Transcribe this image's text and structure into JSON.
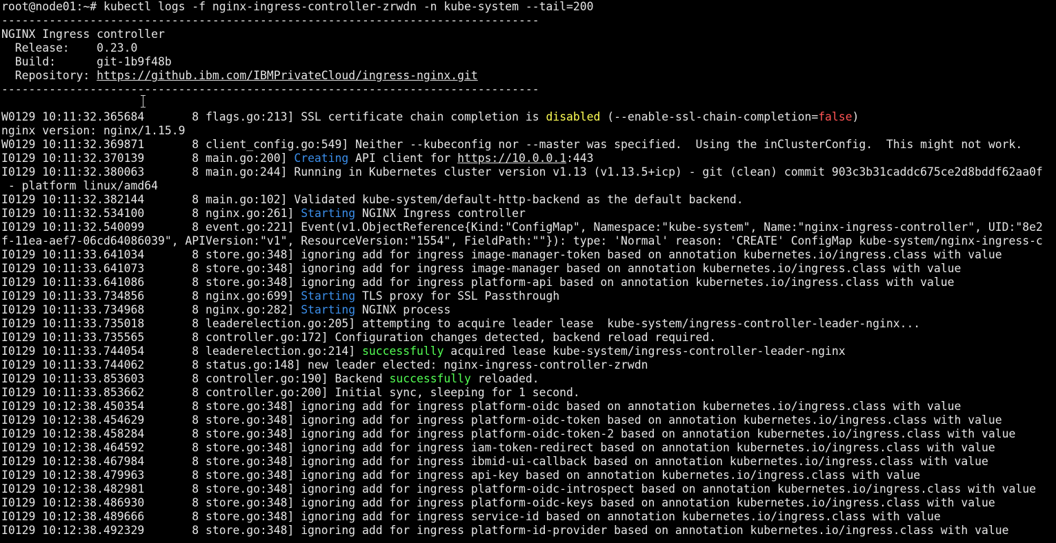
{
  "terminal": {
    "colors": {
      "background": "#000000",
      "text": "#e5e5e5",
      "yellow": "#ffff54",
      "red": "#ff5454",
      "blue": "#3b8eea",
      "green": "#54ff54"
    },
    "lines": [
      {
        "segments": [
          {
            "t": "root@node01:~# kubectl logs -f nginx-ingress-controller-zrwdn -n kube-system --tail=200",
            "c": "plain"
          }
        ]
      },
      {
        "segments": [
          {
            "t": "-------------------------------------------------------------------------------",
            "c": "plain"
          }
        ]
      },
      {
        "segments": [
          {
            "t": "NGINX Ingress controller",
            "c": "plain"
          }
        ]
      },
      {
        "segments": [
          {
            "t": "  Release:    0.23.0",
            "c": "plain"
          }
        ]
      },
      {
        "segments": [
          {
            "t": "  Build:      git-1b9f48b",
            "c": "plain"
          }
        ]
      },
      {
        "segments": [
          {
            "t": "  Repository: ",
            "c": "plain"
          },
          {
            "t": "https://github.ibm.com/IBMPrivateCloud/ingress-nginx.git",
            "c": "link"
          }
        ]
      },
      {
        "segments": [
          {
            "t": "-------------------------------------------------------------------------------",
            "c": "plain"
          }
        ]
      },
      {
        "segments": [
          {
            "t": "",
            "c": "plain"
          }
        ]
      },
      {
        "segments": [
          {
            "t": "W0129 10:11:32.365684       8 flags.go:213] SSL certificate chain completion is ",
            "c": "plain"
          },
          {
            "t": "disabled",
            "c": "yellow"
          },
          {
            "t": " (--enable-ssl-chain-completion=",
            "c": "plain"
          },
          {
            "t": "false",
            "c": "red"
          },
          {
            "t": ")",
            "c": "plain"
          }
        ]
      },
      {
        "segments": [
          {
            "t": "nginx version: nginx/1.15.9",
            "c": "plain"
          }
        ]
      },
      {
        "segments": [
          {
            "t": "W0129 10:11:32.369871       8 client_config.go:549] Neither --kubeconfig nor --master was specified.  Using the inClusterConfig.  This might not work.",
            "c": "plain"
          }
        ]
      },
      {
        "segments": [
          {
            "t": "I0129 10:11:32.370139       8 main.go:200] ",
            "c": "plain"
          },
          {
            "t": "Creating",
            "c": "blue"
          },
          {
            "t": " API client for ",
            "c": "plain"
          },
          {
            "t": "https://10.0.0.1",
            "c": "link"
          },
          {
            "t": ":443",
            "c": "plain"
          }
        ]
      },
      {
        "segments": [
          {
            "t": "I0129 10:11:32.380063       8 main.go:244] Running in Kubernetes cluster version v1.13 (v1.13.5+icp) - git (clean) commit 903c3b31caddc675ce2d8bddf62aa0f",
            "c": "plain"
          }
        ]
      },
      {
        "segments": [
          {
            "t": " - platform linux/amd64",
            "c": "plain"
          }
        ]
      },
      {
        "segments": [
          {
            "t": "I0129 10:11:32.382144       8 main.go:102] Validated kube-system/default-http-backend as the default backend.",
            "c": "plain"
          }
        ]
      },
      {
        "segments": [
          {
            "t": "I0129 10:11:32.534100       8 nginx.go:261] ",
            "c": "plain"
          },
          {
            "t": "Starting",
            "c": "blue"
          },
          {
            "t": " NGINX Ingress controller",
            "c": "plain"
          }
        ]
      },
      {
        "segments": [
          {
            "t": "I0129 10:11:32.540099       8 event.go:221] Event(v1.ObjectReference{Kind:\"ConfigMap\", Namespace:\"kube-system\", Name:\"nginx-ingress-controller\", UID:\"8e2",
            "c": "plain"
          }
        ]
      },
      {
        "segments": [
          {
            "t": "f-11ea-aef7-06cd64086039\", APIVersion:\"v1\", ResourceVersion:\"1554\", FieldPath:\"\"}): type: 'Normal' reason: 'CREATE' ConfigMap kube-system/nginx-ingress-c",
            "c": "plain"
          }
        ]
      },
      {
        "segments": [
          {
            "t": "I0129 10:11:33.641034       8 store.go:348] ignoring add for ingress image-manager-token based on annotation kubernetes.io/ingress.class with value",
            "c": "plain"
          }
        ]
      },
      {
        "segments": [
          {
            "t": "I0129 10:11:33.641073       8 store.go:348] ignoring add for ingress image-manager based on annotation kubernetes.io/ingress.class with value",
            "c": "plain"
          }
        ]
      },
      {
        "segments": [
          {
            "t": "I0129 10:11:33.641086       8 store.go:348] ignoring add for ingress platform-api based on annotation kubernetes.io/ingress.class with value",
            "c": "plain"
          }
        ]
      },
      {
        "segments": [
          {
            "t": "I0129 10:11:33.734856       8 nginx.go:699] ",
            "c": "plain"
          },
          {
            "t": "Starting",
            "c": "blue"
          },
          {
            "t": " TLS proxy for SSL Passthrough",
            "c": "plain"
          }
        ]
      },
      {
        "segments": [
          {
            "t": "I0129 10:11:33.734968       8 nginx.go:282] ",
            "c": "plain"
          },
          {
            "t": "Starting",
            "c": "blue"
          },
          {
            "t": " NGINX process",
            "c": "plain"
          }
        ]
      },
      {
        "segments": [
          {
            "t": "I0129 10:11:33.735018       8 leaderelection.go:205] attempting to acquire leader lease  kube-system/ingress-controller-leader-nginx...",
            "c": "plain"
          }
        ]
      },
      {
        "segments": [
          {
            "t": "I0129 10:11:33.735565       8 controller.go:172] Configuration changes detected, backend reload required.",
            "c": "plain"
          }
        ]
      },
      {
        "segments": [
          {
            "t": "I0129 10:11:33.744054       8 leaderelection.go:214] ",
            "c": "plain"
          },
          {
            "t": "successfully",
            "c": "green"
          },
          {
            "t": " acquired lease kube-system/ingress-controller-leader-nginx",
            "c": "plain"
          }
        ]
      },
      {
        "segments": [
          {
            "t": "I0129 10:11:33.744062       8 status.go:148] new leader elected: nginx-ingress-controller-zrwdn",
            "c": "plain"
          }
        ]
      },
      {
        "segments": [
          {
            "t": "I0129 10:11:33.853603       8 controller.go:190] Backend ",
            "c": "plain"
          },
          {
            "t": "successfully",
            "c": "green"
          },
          {
            "t": " reloaded.",
            "c": "plain"
          }
        ]
      },
      {
        "segments": [
          {
            "t": "I0129 10:11:33.853662       8 controller.go:200] Initial sync, sleeping for 1 second.",
            "c": "plain"
          }
        ]
      },
      {
        "segments": [
          {
            "t": "I0129 10:12:38.450354       8 store.go:348] ignoring add for ingress platform-oidc based on annotation kubernetes.io/ingress.class with value",
            "c": "plain"
          }
        ]
      },
      {
        "segments": [
          {
            "t": "I0129 10:12:38.454629       8 store.go:348] ignoring add for ingress platform-oidc-token based on annotation kubernetes.io/ingress.class with value",
            "c": "plain"
          }
        ]
      },
      {
        "segments": [
          {
            "t": "I0129 10:12:38.458284       8 store.go:348] ignoring add for ingress platform-oidc-token-2 based on annotation kubernetes.io/ingress.class with value",
            "c": "plain"
          }
        ]
      },
      {
        "segments": [
          {
            "t": "I0129 10:12:38.464592       8 store.go:348] ignoring add for ingress iam-token-redirect based on annotation kubernetes.io/ingress.class with value",
            "c": "plain"
          }
        ]
      },
      {
        "segments": [
          {
            "t": "I0129 10:12:38.467984       8 store.go:348] ignoring add for ingress ibmid-ui-callback based on annotation kubernetes.io/ingress.class with value",
            "c": "plain"
          }
        ]
      },
      {
        "segments": [
          {
            "t": "I0129 10:12:38.479963       8 store.go:348] ignoring add for ingress api-key based on annotation kubernetes.io/ingress.class with value",
            "c": "plain"
          }
        ]
      },
      {
        "segments": [
          {
            "t": "I0129 10:12:38.482981       8 store.go:348] ignoring add for ingress platform-oidc-introspect based on annotation kubernetes.io/ingress.class with value",
            "c": "plain"
          }
        ]
      },
      {
        "segments": [
          {
            "t": "I0129 10:12:38.486930       8 store.go:348] ignoring add for ingress platform-oidc-keys based on annotation kubernetes.io/ingress.class with value",
            "c": "plain"
          }
        ]
      },
      {
        "segments": [
          {
            "t": "I0129 10:12:38.489666       8 store.go:348] ignoring add for ingress service-id based on annotation kubernetes.io/ingress.class with value",
            "c": "plain"
          }
        ]
      },
      {
        "segments": [
          {
            "t": "I0129 10:12:38.492329       8 store.go:348] ignoring add for ingress platform-id-provider based on annotation kubernetes.io/ingress.class with value",
            "c": "plain"
          }
        ]
      }
    ]
  }
}
